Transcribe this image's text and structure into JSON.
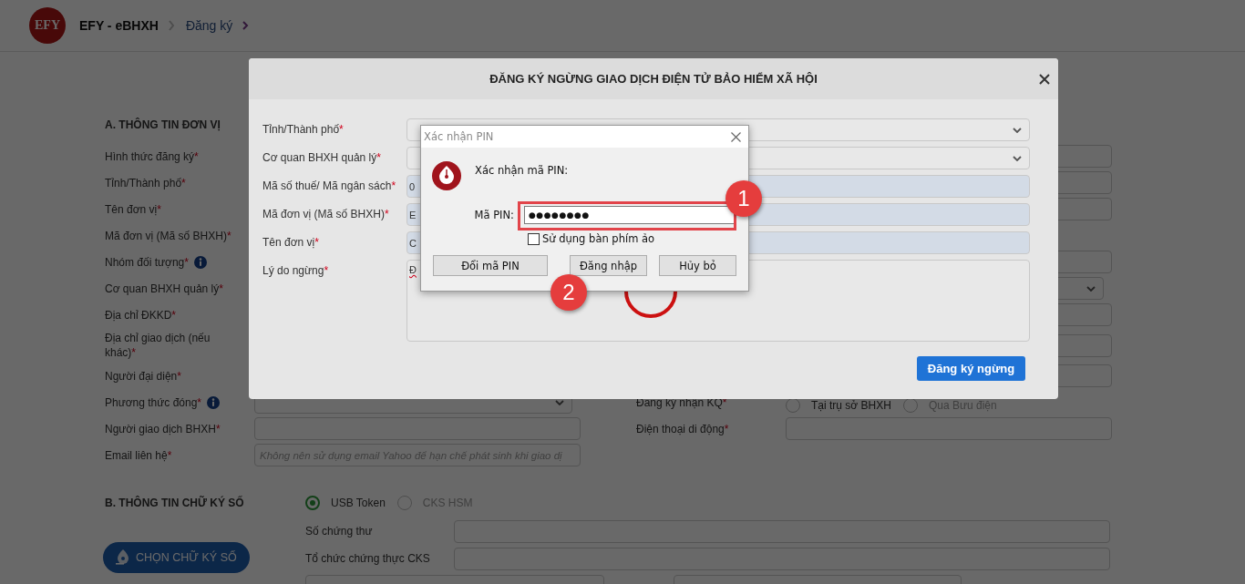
{
  "header": {
    "logo_text": "EFY",
    "breadcrumb": [
      {
        "label": "EFY - eBHXH",
        "kind": "title"
      },
      {
        "label": "Đăng ký",
        "kind": "link"
      }
    ]
  },
  "section_a": {
    "title": "A. THÔNG TIN ĐƠN VỊ",
    "rows": [
      {
        "left": {
          "label": "Hình thức đăng ký",
          "asterisk": "*"
        },
        "right": {
          "kind": "input"
        }
      },
      {
        "left": {
          "label": "Tỉnh/Thành phố",
          "asterisk": "*"
        },
        "right": {
          "kind": "input"
        }
      },
      {
        "left": {
          "label": "Tên đơn vị",
          "asterisk": "*"
        },
        "right": {
          "kind": "input"
        }
      },
      {
        "left": {
          "label": "Mã đơn vị (Mã số BHXH)",
          "asterisk": "*"
        }
      },
      {
        "left": {
          "label": "Nhóm đối tượng",
          "asterisk": "*",
          "info": true
        },
        "right": {
          "kind": "input"
        }
      },
      {
        "left": {
          "label": "Cơ quan BHXH quản lý",
          "asterisk": "*"
        },
        "right": {
          "kind": "select"
        }
      },
      {
        "left": {
          "label": "Địa chỉ ĐKKD",
          "asterisk": "*"
        },
        "right": {
          "kind": "input"
        }
      },
      {
        "kind": "tall",
        "left": {
          "label": "Địa chỉ giao dịch (nếu khác)",
          "asterisk": "*"
        },
        "right": {
          "kind": "input"
        }
      },
      {
        "left": {
          "label": "Người đại diện",
          "asterisk": "*"
        },
        "right": {
          "kind": "input"
        }
      },
      {
        "left": {
          "label": "Phương thức đóng",
          "asterisk": "*",
          "info": true,
          "kind": "select"
        },
        "right": {
          "kind": "radios",
          "label": "Đăng ký nhận KQ",
          "asterisk": "*",
          "options": [
            {
              "label": "Tại trụ sở BHXH",
              "selected": false,
              "disabled": false
            },
            {
              "label": "Qua Bưu điện",
              "selected": false,
              "disabled": true
            }
          ]
        }
      },
      {
        "left": {
          "label": "Người giao dịch BHXH",
          "asterisk": "*",
          "kind": "input"
        },
        "right": {
          "kind": "input",
          "label": "Điện thoại di động",
          "asterisk": "*"
        }
      },
      {
        "left": {
          "label": "Email liên hệ",
          "asterisk": "*",
          "kind": "input",
          "placeholder": "Không nên sử dụng email Yahoo để hạn chế phát sinh khi giao dị"
        }
      }
    ]
  },
  "section_b": {
    "title": "B. THÔNG TIN CHỮ KÝ SỐ",
    "options": [
      {
        "label": "USB Token",
        "selected": true
      },
      {
        "label": "CKS HSM",
        "selected": false
      }
    ],
    "fields": [
      {
        "label": "Số chứng thư"
      },
      {
        "label": "Tổ chức chứng thực CKS"
      }
    ],
    "button": "CHỌN CHỮ KÝ SỐ"
  },
  "modal": {
    "title": "ĐĂNG KÝ NGỪNG GIAO DỊCH ĐIỆN TỬ BẢO HIỂM XÃ HỘI",
    "loading": true,
    "rows": [
      {
        "label": "Tỉnh/Thành phố",
        "asterisk": "*",
        "kind": "select"
      },
      {
        "label": "Cơ quan BHXH quản lý",
        "asterisk": "*",
        "kind": "select"
      },
      {
        "label": "Mã số thuế/ Mã ngân sách",
        "asterisk": "*",
        "kind": "readonly",
        "value": "0"
      },
      {
        "label": "Mã đơn vị (Mã số BHXH)",
        "asterisk": "*",
        "kind": "readonly",
        "value": "E"
      },
      {
        "label": "Tên đơn vị",
        "asterisk": "*",
        "kind": "readonly",
        "value": "C"
      },
      {
        "label": "Lý do ngừng",
        "asterisk": "*",
        "kind": "textarea",
        "value": "Đ"
      }
    ],
    "submit": "Đăng ký ngừng"
  },
  "pin_dialog": {
    "title": "Xác nhận PIN",
    "prompt": "Xác nhận mã PIN:",
    "pin_label": "Mã PIN:",
    "pin_value": "●●●●●●●●",
    "pin_highlighted": true,
    "virtual_keyboard": {
      "label": "Sử dụng bàn phím ảo",
      "checked": false
    },
    "buttons": [
      "Đổi mã PIN",
      "Đăng nhập",
      "Hủy bỏ"
    ]
  },
  "annotations": [
    {
      "label": "1"
    },
    {
      "label": "2"
    }
  ]
}
